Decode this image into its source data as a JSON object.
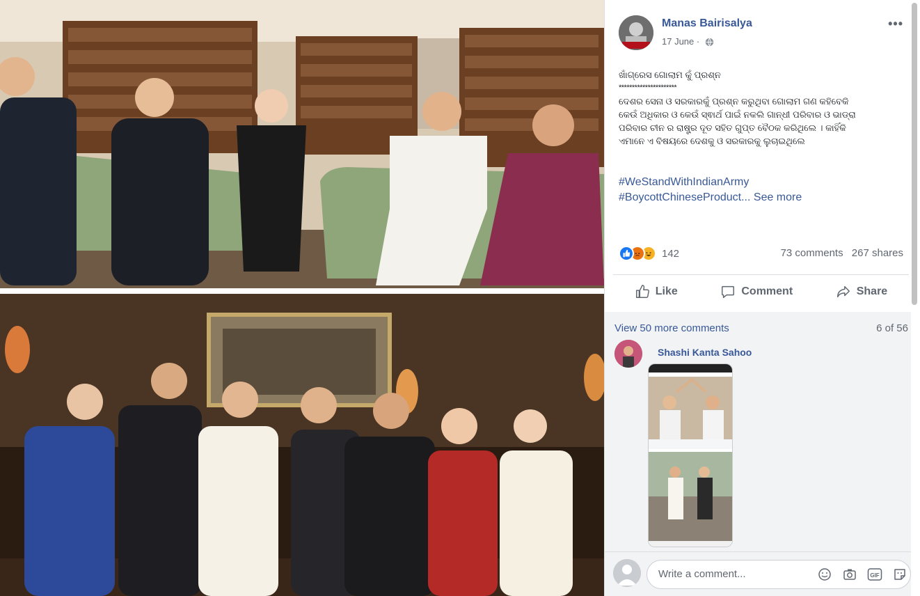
{
  "post": {
    "author": "Manas Bairisalya",
    "date": "17 June",
    "more": "•••",
    "body_title": "ଖାଁଗ୍ରେସ ଗୋଲାମ କୁଁ ପ୍ରଶ୍ନ",
    "body_stars": "**********************",
    "body_lines": [
      "ଦେଶର ସେନା ଓ ସରକାରକୁଁ ପ୍ରଶ୍ନ କରୁଥିବା ଗୋଲାମ ଗଣ କହିବେକି",
      "କେଉଁ ଅଧିକାର ଓ କେଉଁ ସ୍ଵାର୍ଥ ପାଇଁ ନକଲି ଗାନ୍ଧୀ ପରିବାର ଓ ଭାଡ୍ରା",
      "ପରିବାର ଚୀନ ର ରାଷ୍ଟ୍ର ଦୂତ ସହିତ ଗୁପ୍ତ ବୈଠକ କରିଥିଲେ । କାହିଁକି",
      "ଏମାନେ ଏ ବିଷୟରେ ଦେଶକୁ ଓ ସରକାରକୁ ଲୁଚାଇଥିଲେ"
    ],
    "hashtag_1": "#WeStandWithIndianArmy",
    "hashtag_2": "#BoycottChineseProduct...",
    "see_more": "See more",
    "reaction_count": "142",
    "comments_count": "73 comments",
    "shares_count": "267 shares"
  },
  "actions": {
    "like": "Like",
    "comment": "Comment",
    "share": "Share"
  },
  "comments": {
    "view_more": "View 50 more comments",
    "paging": "6 of 56",
    "first_author": "Shashi Kanta Sahoo",
    "input_placeholder": "Write a comment..."
  },
  "icons": {
    "reaction_like": "thumbs-up-icon",
    "reaction_angry": "angry-face-icon",
    "reaction_haha": "laughing-face-icon",
    "globe": "globe-icon",
    "emoji": "emoji-icon",
    "camera": "camera-icon",
    "gif": "gif-icon",
    "sticker": "sticker-icon"
  },
  "colors": {
    "link": "#385898",
    "like_blue": "#1877f2",
    "angry_orange": "#e9710f",
    "haha_yellow": "#f7b125"
  }
}
